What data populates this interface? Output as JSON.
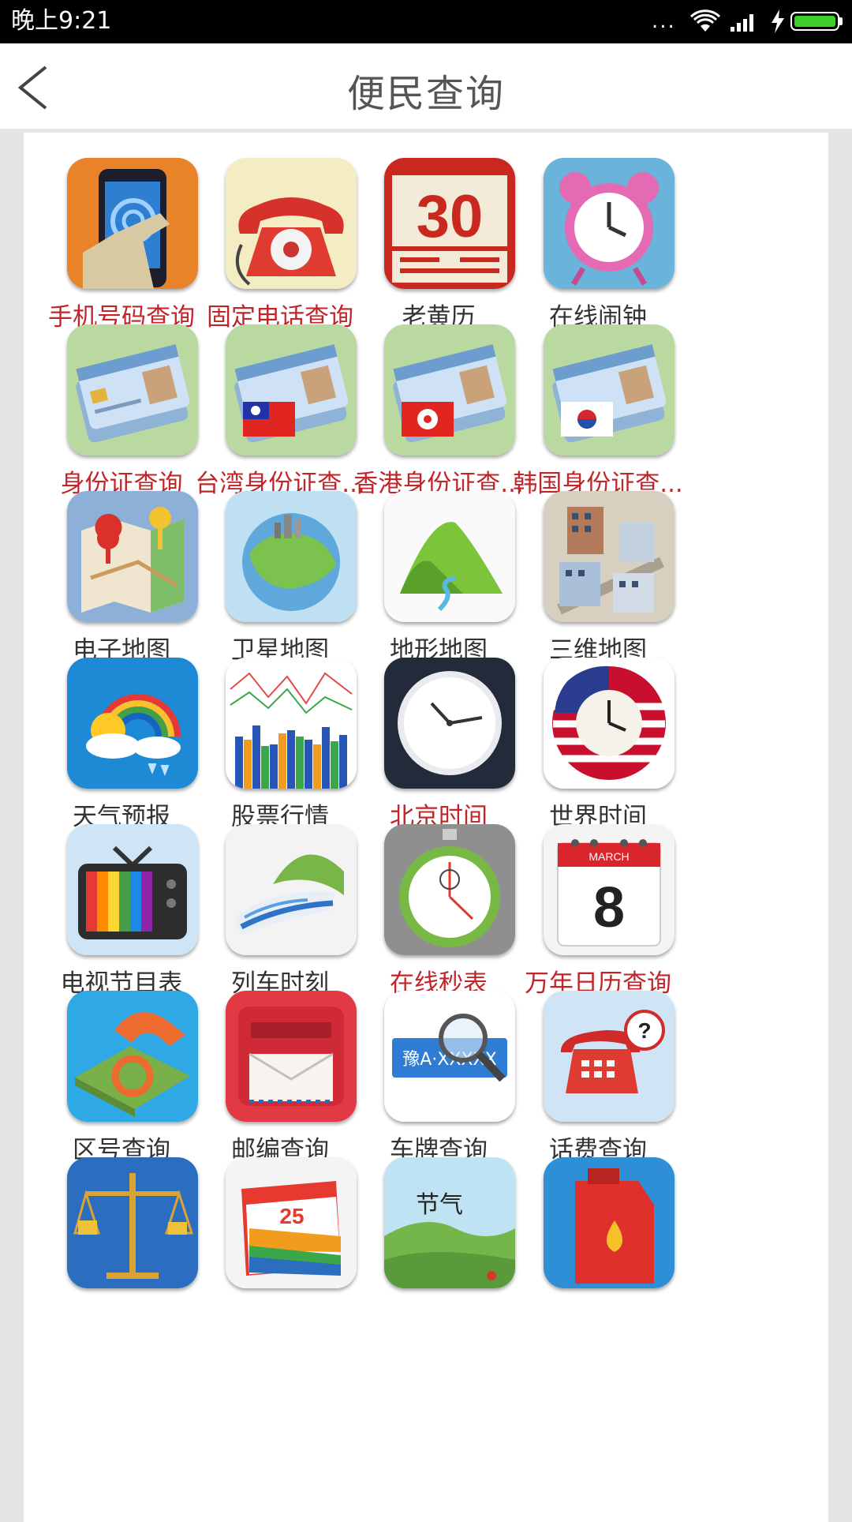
{
  "status_bar": {
    "time": "晚上9:21",
    "dots": "..."
  },
  "header": {
    "title": "便民查询"
  },
  "colors": {
    "accent_red": "#c0252a",
    "label_gray": "#333333",
    "battery_green": "#3ccf2a"
  },
  "items": [
    {
      "label": "手机号码查询",
      "icon": "mobile-touch-icon",
      "highlight": true
    },
    {
      "label": "固定电话查询",
      "icon": "rotary-phone-icon",
      "highlight": true
    },
    {
      "label": "老黄历",
      "icon": "calendar-30-icon",
      "highlight": false
    },
    {
      "label": "在线闹钟",
      "icon": "alarm-clock-icon",
      "highlight": false
    },
    {
      "label": "身份证查询",
      "icon": "id-card-icon",
      "highlight": true
    },
    {
      "label": "台湾身份证查...",
      "icon": "id-card-taiwan-icon",
      "highlight": true
    },
    {
      "label": "香港身份证查...",
      "icon": "id-card-hongkong-icon",
      "highlight": true
    },
    {
      "label": "韩国身份证查...",
      "icon": "id-card-korea-icon",
      "highlight": true
    },
    {
      "label": "电子地图",
      "icon": "map-pins-icon",
      "highlight": false
    },
    {
      "label": "卫星地图",
      "icon": "globe-icon",
      "highlight": false
    },
    {
      "label": "地形地图",
      "icon": "terrain-icon",
      "highlight": false
    },
    {
      "label": "三维地图",
      "icon": "buildings-3d-icon",
      "highlight": false
    },
    {
      "label": "天气预报",
      "icon": "weather-rainbow-icon",
      "highlight": false
    },
    {
      "label": "股票行情",
      "icon": "stock-chart-icon",
      "highlight": false
    },
    {
      "label": "北京时间",
      "icon": "wall-clock-icon",
      "highlight": true
    },
    {
      "label": "世界时间",
      "icon": "usa-clock-icon",
      "highlight": false
    },
    {
      "label": "电视节目表",
      "icon": "tv-icon",
      "highlight": false
    },
    {
      "label": "列车时刻",
      "icon": "train-icon",
      "highlight": false
    },
    {
      "label": "在线秒表",
      "icon": "stopwatch-icon",
      "highlight": true
    },
    {
      "label": "万年日历查询",
      "icon": "calendar-8-icon",
      "highlight": true
    },
    {
      "label": "区号查询",
      "icon": "phone-book-icon",
      "highlight": false
    },
    {
      "label": "邮编查询",
      "icon": "mailbox-icon",
      "highlight": false
    },
    {
      "label": "车牌查询",
      "icon": "license-plate-icon",
      "highlight": false
    },
    {
      "label": "话费查询",
      "icon": "phone-bill-icon",
      "highlight": false
    },
    {
      "label": "",
      "icon": "scale-gold-icon",
      "highlight": false
    },
    {
      "label": "",
      "icon": "tear-calendar-icon",
      "highlight": false
    },
    {
      "label": "",
      "icon": "solar-terms-icon",
      "highlight": false
    },
    {
      "label": "",
      "icon": "oil-can-icon",
      "highlight": false
    }
  ],
  "icon_text": {
    "calendar_day": "30",
    "calendar_month_day": "8",
    "calendar_month": "MARCH",
    "plate": "豫A·XXXXX",
    "solar_term": "节气",
    "tear_day": "25"
  }
}
